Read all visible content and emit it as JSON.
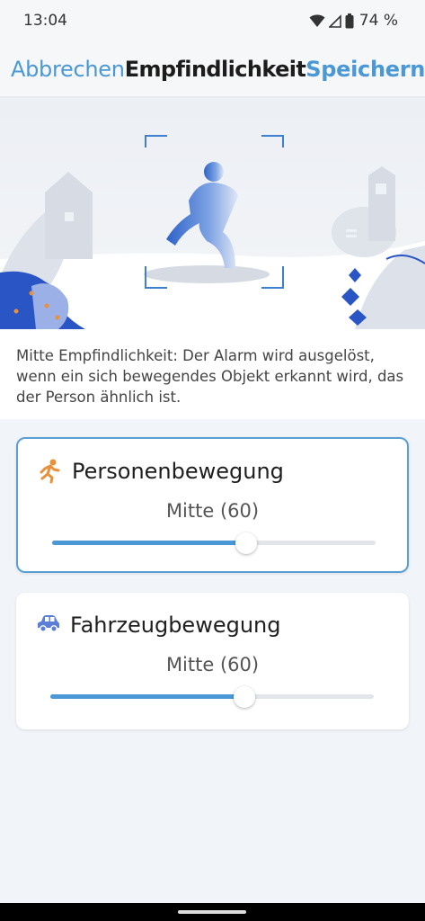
{
  "status_bar": {
    "time": "13:04",
    "battery": "74 %"
  },
  "header": {
    "cancel_label": "Abbrechen",
    "title": "Empfindlichkeit",
    "save_label": "Speichern"
  },
  "description": "Mitte Empfindlichkeit: Der Alarm wird ausgelöst, wenn ein sich bewegendes Objekt erkannt wird, das der Person ähnlich ist.",
  "cards": [
    {
      "title": "Personenbewegung",
      "icon": "running-person-icon",
      "value_label": "Mitte (60)",
      "value": 60,
      "selected": true
    },
    {
      "title": "Fahrzeugbewegung",
      "icon": "car-icon",
      "value_label": "Mitte (60)",
      "value": 60,
      "selected": false
    }
  ],
  "colors": {
    "accent": "#4a98d6",
    "person_icon": "#e8913a",
    "car_icon": "#5b7fd6"
  }
}
